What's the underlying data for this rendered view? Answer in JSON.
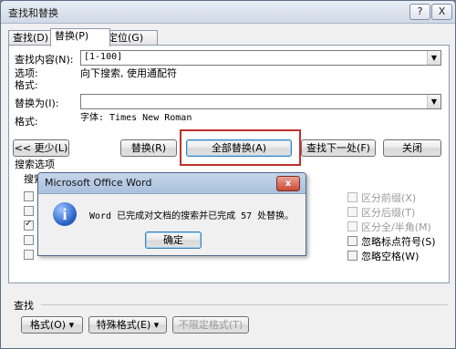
{
  "window": {
    "title": "查找和替换",
    "help_label": "?",
    "close_label": "X"
  },
  "tabs": [
    {
      "label": "查找(D)"
    },
    {
      "label": "替换(P)"
    },
    {
      "label": "定位(G)"
    }
  ],
  "find": {
    "label": "查找内容(N):",
    "value": "[1-100]",
    "options_label": "选项:",
    "options_value": "向下搜索, 使用通配符",
    "format_label": "格式:"
  },
  "replace": {
    "label": "替换为(I):",
    "value": "",
    "format_label": "格式:",
    "format_value": "字体: Times New Roman"
  },
  "buttons": {
    "less": "<< 更少(L)",
    "replace": "替换(R)",
    "replace_all": "全部替换(A)",
    "find_next": "查找下一处(F)",
    "close": "关闭"
  },
  "search_options": {
    "header": "搜索选项",
    "search_label_partial": "搜索"
  },
  "right_options": [
    {
      "label": "区分前缀(X)",
      "enabled": false,
      "checked": false
    },
    {
      "label": "区分后缀(T)",
      "enabled": false,
      "checked": false
    },
    {
      "label": "区分全/半角(M)",
      "enabled": false,
      "checked": false
    },
    {
      "label": "忽略标点符号(S)",
      "enabled": true,
      "checked": false
    },
    {
      "label": "忽略空格(W)",
      "enabled": true,
      "checked": false
    }
  ],
  "bottom": {
    "find_label": "查找",
    "format_button": "格式(O) ▾",
    "special_button": "特殊格式(E) ▾",
    "no_format_button": "不限定格式(T)"
  },
  "messagebox": {
    "title": "Microsoft Office Word",
    "close_label": "x",
    "message": "Word 已完成对文档的搜索并已完成 57 处替换。",
    "ok_label": "确定",
    "icon": "info-icon"
  }
}
